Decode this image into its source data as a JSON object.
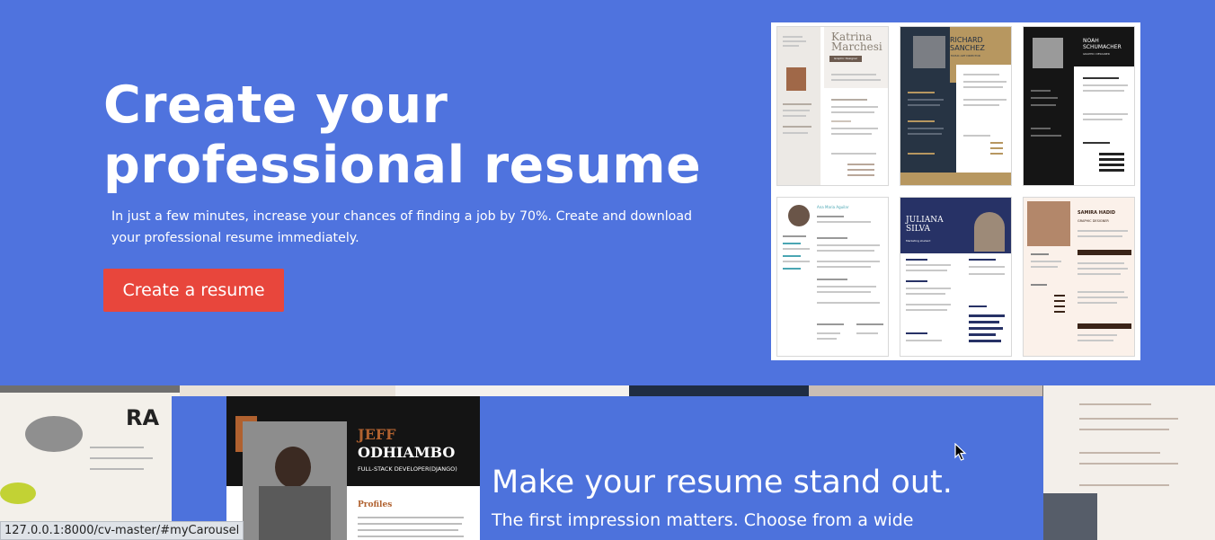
{
  "hero": {
    "title_line1": "Create your",
    "title_line2": "professional resume",
    "subtitle_line1": "In just a few minutes, increase your chances of finding a job by 70%. Create and download",
    "subtitle_line2": "your professional resume immediately.",
    "cta_label": "Create a resume"
  },
  "templates": [
    {
      "name_line1": "Katrina",
      "name_line2": "Marchesi",
      "role": "Graphic Designer"
    },
    {
      "name_line1": "RICHARD",
      "name_line2": "SANCHEZ",
      "role": "MUSIC ART DIRECTOR"
    },
    {
      "name_line1": "NOAH",
      "name_line2": "SCHUMACHER",
      "role": "GRAPHIC DESIGNER"
    },
    {
      "name_line1": "Ana Maria Aguilar",
      "name_line2": "",
      "role": ""
    },
    {
      "name_line1": "JULIANA",
      "name_line2": "SILVA",
      "role": "Marketing student"
    },
    {
      "name_line1": "SAMIRA HADID",
      "name_line2": "",
      "role": "GRAPHIC DESIGNER"
    }
  ],
  "carousel": {
    "featured_first": "JEFF",
    "featured_last": "ODHIAMBO",
    "featured_role": "FULL-STACK DEVELOPER(DJANGO)",
    "featured_section": "Profiles",
    "heading": "Make your resume stand out.",
    "subheading": "The first impression matters. Choose from a wide"
  },
  "status_url": "127.0.0.1:8000/cv-master/#myCarousel",
  "colors": {
    "hero_bg": "#4f73de",
    "cta_bg": "#e8463c",
    "panel_bg": "#4d72dc"
  }
}
